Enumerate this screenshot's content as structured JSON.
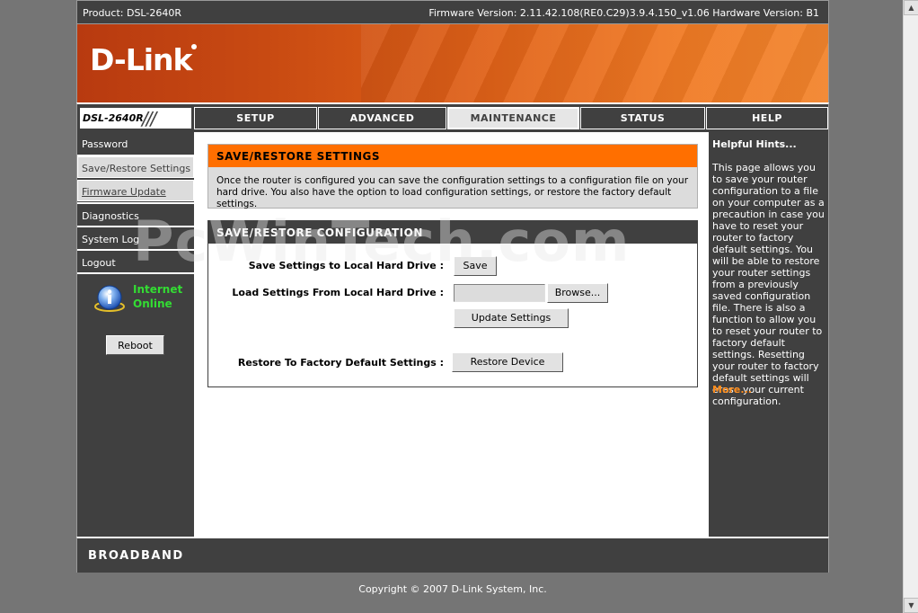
{
  "topbar": {
    "product": "Product: DSL-2640R",
    "firmware": "Firmware Version: 2.11.42.108(RE0.C29)3.9.4.150_v1.06 Hardware Version: B1"
  },
  "banner": {
    "logo": "D-Link"
  },
  "nav": {
    "model": "DSL-2640R",
    "tabs": [
      {
        "label": "SETUP"
      },
      {
        "label": "ADVANCED"
      },
      {
        "label": "MAINTENANCE",
        "active": true
      },
      {
        "label": "STATUS"
      },
      {
        "label": "HELP"
      }
    ]
  },
  "sidebar": {
    "items": [
      {
        "label": "Password"
      },
      {
        "label": "Save/Restore Settings"
      },
      {
        "label": "Firmware Update"
      },
      {
        "label": "Diagnostics"
      },
      {
        "label": "System Log"
      },
      {
        "label": "Logout"
      }
    ],
    "internet_line1": "Internet",
    "internet_line2": "Online",
    "reboot_label": "Reboot"
  },
  "main": {
    "section1_title": "SAVE/RESTORE SETTINGS",
    "section1_desc": "Once the router is configured you can save the configuration settings to a configuration file on your hard drive. You also have the option to load configuration settings, or restore the factory default settings.",
    "section2_title": "SAVE/RESTORE CONFIGURATION",
    "save_label": "Save Settings to Local Hard Drive :",
    "save_button": "Save",
    "load_label": "Load Settings From Local Hard Drive :",
    "file_value": "",
    "browse_button": "Browse...",
    "update_button": "Update Settings",
    "restore_label": "Restore To Factory Default Settings :",
    "restore_button": "Restore Device"
  },
  "hints": {
    "title": "Helpful Hints...",
    "text": "This page allows you to save your router configuration to a file on your computer as a precaution in case you have to reset your router to factory default settings. You will be able to restore your router settings from a previously saved configuration file. There is also a function to allow you to reset your router to factory default settings. Resetting your router to factory default settings will erase your current configuration.",
    "more": "More..."
  },
  "footer": {
    "brand": "BROADBAND",
    "copyright": "Copyright © 2007 D-Link System, Inc."
  },
  "watermark": "PcWinTech.com",
  "colors": {
    "accent_orange": "#ff6f00",
    "dark_gray": "#404040",
    "status_green": "#33dd33",
    "hint_more": "#ff8c1a"
  }
}
